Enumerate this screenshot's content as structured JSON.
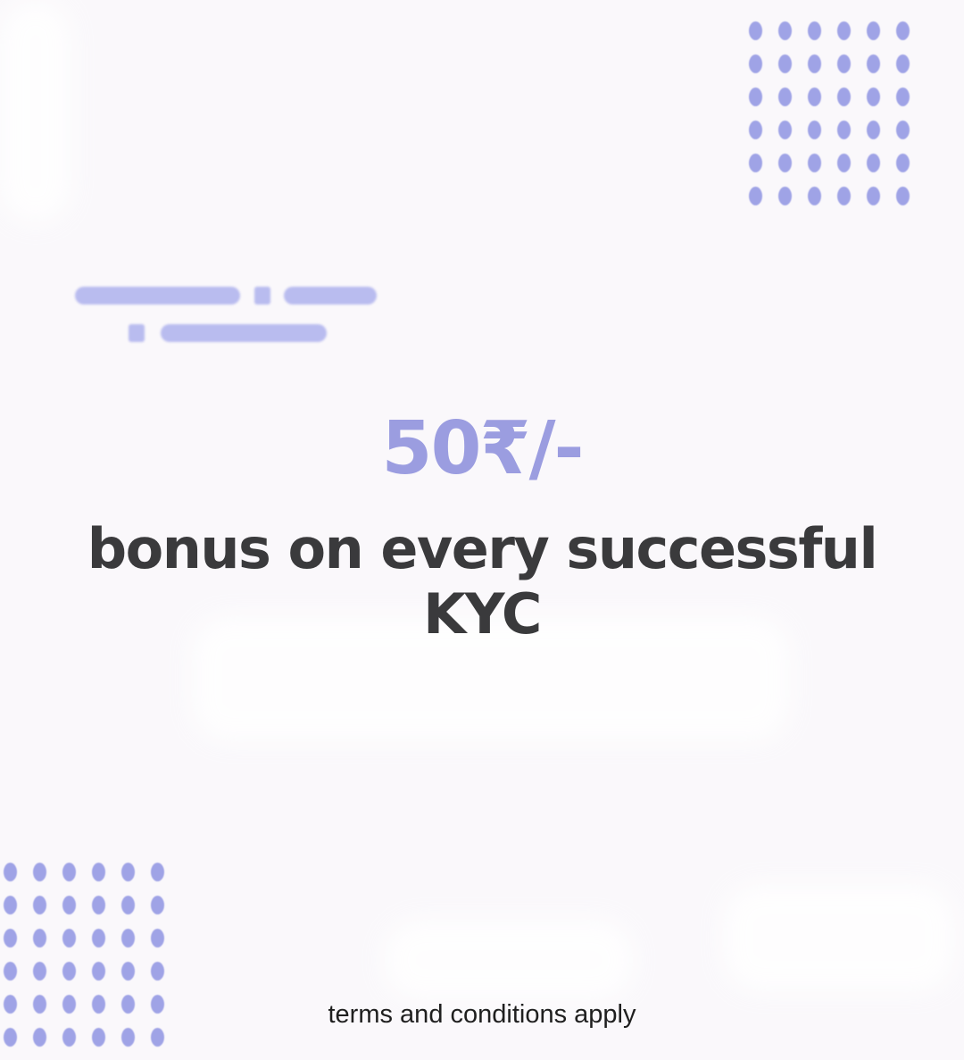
{
  "colors": {
    "background": "#faf8fb",
    "accent": "#9b9de0",
    "dots": "#9fa3e6",
    "headline": "#3a3a3c",
    "terms": "#1f1f1f"
  },
  "price": "50₹/-",
  "headline": "bonus on every successful KYC",
  "footer": {
    "terms": "terms and conditions apply"
  }
}
